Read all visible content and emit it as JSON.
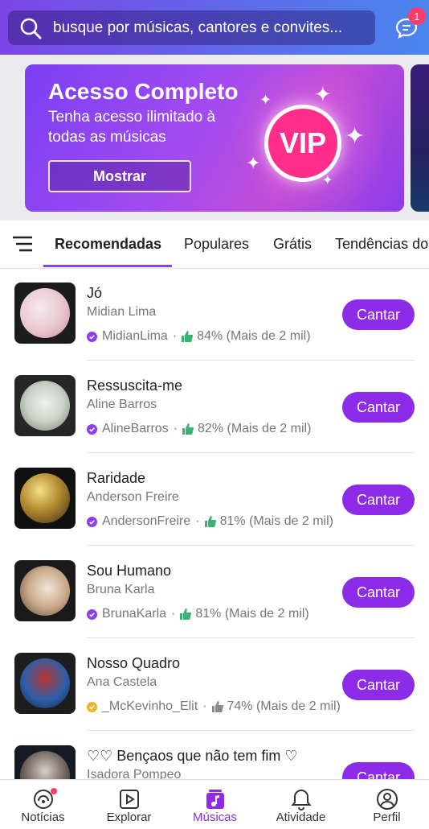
{
  "search": {
    "placeholder": "busque por músicas, cantores e convites...",
    "icon": "search-icon"
  },
  "header": {
    "chat_badge": "1",
    "chat_icon": "chat-icon"
  },
  "banner": {
    "title": "Acesso Completo",
    "subtitle": "Tenha acesso ilimitado à todas as músicas",
    "button": "Mostrar",
    "badge": "VIP"
  },
  "tabs": [
    "Recomendadas",
    "Populares",
    "Grátis",
    "Tendências do"
  ],
  "active_tab": "Recomendadas",
  "songs": [
    {
      "title": "Jó",
      "artist": "Midian Lima",
      "uploader": "MidianLima",
      "rating": "84% (Mais de 2 mil)",
      "verified": "purple",
      "action": "Cantar"
    },
    {
      "title": "Ressuscita-me",
      "artist": "Aline Barros",
      "uploader": "AlineBarros",
      "rating": "82% (Mais de 2 mil)",
      "verified": "purple",
      "action": "Cantar"
    },
    {
      "title": "Raridade",
      "artist": "Anderson Freire",
      "uploader": "AndersonFreire",
      "rating": "81% (Mais de 2 mil)",
      "verified": "purple",
      "action": "Cantar"
    },
    {
      "title": "Sou Humano",
      "artist": "Bruna Karla",
      "uploader": "BrunaKarla",
      "rating": "81% (Mais de 2 mil)",
      "verified": "purple",
      "action": "Cantar"
    },
    {
      "title": "Nosso Quadro",
      "artist": "Ana Castela",
      "uploader": "_McKevinho_Elit",
      "rating": "74% (Mais de 2 mil)",
      "verified": "gold",
      "action": "Cantar"
    },
    {
      "title": "♡♡ Bençaos que não tem fim ♡",
      "artist": "Isadora Pompeo",
      "uploader": "",
      "rating": "",
      "verified": "",
      "action": "Cantar"
    }
  ],
  "nav": [
    {
      "label": "Notícias",
      "icon": "news-icon"
    },
    {
      "label": "Explorar",
      "icon": "explore-icon"
    },
    {
      "label": "Músicas",
      "icon": "music-icon"
    },
    {
      "label": "Atividade",
      "icon": "bell-icon"
    },
    {
      "label": "Perfil",
      "icon": "profile-icon"
    }
  ],
  "colors": {
    "accent": "#8c2be8",
    "badge": "#ff3b6b",
    "thumb_green": "#3bb273"
  }
}
